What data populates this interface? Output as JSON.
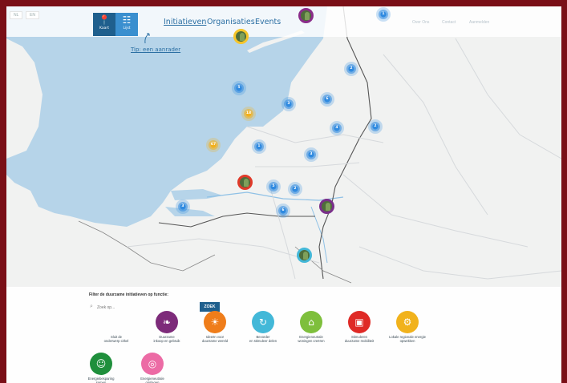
{
  "topbar": {
    "language_options": [
      "NL",
      "EN"
    ],
    "view_buttons": [
      {
        "label": "Kaart",
        "icon": "map-pin-icon",
        "color": "#1f5f8d"
      },
      {
        "label": "Lijst",
        "icon": "list-grid-icon",
        "color": "#3a8fcf"
      }
    ],
    "nav": [
      {
        "label": "Initiatieven",
        "active": true
      },
      {
        "label": "Organisaties",
        "active": false
      },
      {
        "label": "Events",
        "active": false
      }
    ],
    "right_links": [
      "Over Ons",
      "Contact",
      "Aanmelden"
    ]
  },
  "hint_text": "Tip: een aanrader",
  "map": {
    "colors": {
      "sea": "#b6d4e9",
      "land": "#f1f2f1",
      "cluster_blue": "#2f8ae0",
      "cluster_yellow": "#f2b01c"
    },
    "clusters": [
      {
        "count": "1",
        "color": "blue"
      },
      {
        "count": "2",
        "color": "blue"
      },
      {
        "count": "5",
        "color": "blue"
      },
      {
        "count": "3",
        "color": "blue"
      },
      {
        "count": "6",
        "color": "blue"
      },
      {
        "count": "18",
        "color": "yellow"
      },
      {
        "count": "2",
        "color": "blue"
      },
      {
        "count": "67",
        "color": "yellow"
      },
      {
        "count": "4",
        "color": "blue"
      },
      {
        "count": "1",
        "color": "blue"
      },
      {
        "count": "3",
        "color": "blue"
      },
      {
        "count": "5",
        "color": "blue"
      },
      {
        "count": "2",
        "color": "blue"
      },
      {
        "count": "6",
        "color": "blue"
      },
      {
        "count": "3",
        "color": "blue"
      }
    ]
  },
  "filter": {
    "title": "Filter de duurzame initiatieven op functie:",
    "search_placeholder": "Zoek op...",
    "search_button": "ZOEK",
    "categories": [
      {
        "label": "Sluit de\nonderwerp cirkel",
        "color": "none",
        "icon": ""
      },
      {
        "label": "Duurzame\ninkoop en gebruik",
        "color": "#7d2b7a",
        "icon": "leaf-icon"
      },
      {
        "label": "Ideeën voor\nduurzame wereld",
        "color": "#ef7d1a",
        "icon": "lightbulb-icon"
      },
      {
        "label": "Bevorder\nen stimuleer delen",
        "color": "#43b8d8",
        "icon": "recycle-icon"
      },
      {
        "label": "Energieneutrale\nwoningen creëren",
        "color": "#7ebf3c",
        "icon": "house-icon"
      },
      {
        "label": "Stimuleren\nduurzame mobiliteit",
        "color": "#df2a26",
        "icon": "car-icon"
      },
      {
        "label": "Lokale regionale energie\nopwekken",
        "color": "#f1b21c",
        "icon": "gear-icon"
      },
      {
        "label": "Energiebesparing\nsamen",
        "color": "#1f8f3c",
        "icon": "people-icon"
      },
      {
        "label": "Energieneutrale\nopslagen",
        "color": "#ec6ba5",
        "icon": "target-icon"
      }
    ]
  }
}
